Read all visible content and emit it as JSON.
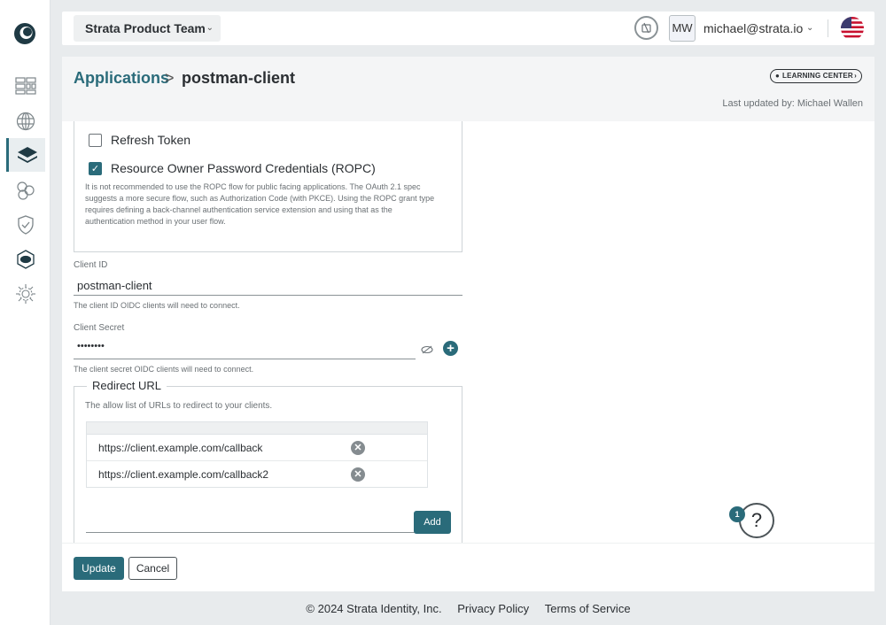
{
  "topbar": {
    "team": "Strata Product Team",
    "avatar_initials": "MW",
    "user_email": "michael@strata.io"
  },
  "header": {
    "breadcrumb_parent": "Applications",
    "breadcrumb_separator": ">",
    "breadcrumb_current": "postman-client",
    "learning_center": "LEARNING CENTER",
    "last_updated": "Last updated by: Michael Wallen"
  },
  "grant_types": {
    "refresh_token": {
      "label": "Refresh Token",
      "checked": false
    },
    "ropc": {
      "label": "Resource Owner Password Credentials (ROPC)",
      "checked": true
    },
    "ropc_help": "It is not recommended to use the ROPC flow for public facing applications. The OAuth 2.1 spec suggests a more secure flow, such as Authorization Code (with PKCE). Using the ROPC grant type requires defining a back-channel authentication service extension and using that as the authentication method in your user flow."
  },
  "client_id": {
    "label": "Client ID",
    "value": "postman-client",
    "help": "The client ID OIDC clients will need to connect."
  },
  "client_secret": {
    "label": "Client Secret",
    "value": "••••••••",
    "help": "The client secret OIDC clients will need to connect."
  },
  "redirect": {
    "legend": "Redirect URL",
    "help": "The allow list of URLs to redirect to your clients.",
    "urls": [
      "https://client.example.com/callback",
      "https://client.example.com/callback2"
    ],
    "add_label": "Add"
  },
  "actions": {
    "update_label": "Update",
    "cancel_label": "Cancel"
  },
  "help": {
    "badge_count": "1",
    "label": "?"
  },
  "footer": {
    "copyright": "© 2024 Strata Identity, Inc.",
    "privacy": "Privacy Policy",
    "terms": "Terms of Service"
  },
  "colors": {
    "accent": "#2a6b7a",
    "background": "#e8ebed"
  }
}
